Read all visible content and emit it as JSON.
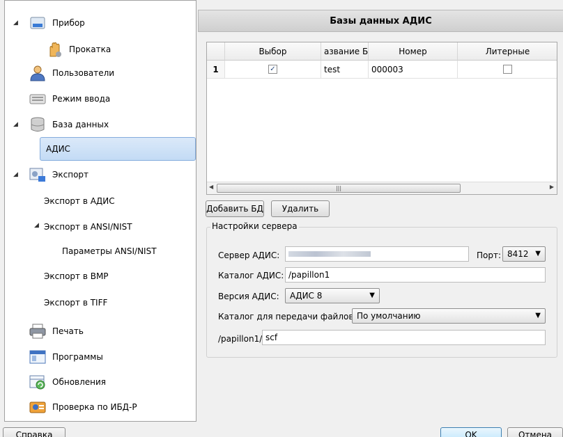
{
  "tree": {
    "items": [
      {
        "label": "Прибор",
        "icon": "device-icon"
      },
      {
        "label": "Прокатка",
        "icon": "hand-icon"
      },
      {
        "label": "Пользователи",
        "icon": "user-icon"
      },
      {
        "label": "Режим ввода",
        "icon": "keyboard-icon"
      },
      {
        "label": "База данных",
        "icon": "database-icon"
      },
      {
        "label": "АДИС"
      },
      {
        "label": "Экспорт",
        "icon": "export-icon"
      },
      {
        "label": "Экспорт в АДИС"
      },
      {
        "label": "Экспорт в ANSI/NIST"
      },
      {
        "label": "Параметры ANSI/NIST"
      },
      {
        "label": "Экспорт в BMP"
      },
      {
        "label": "Экспорт в TIFF"
      },
      {
        "label": "Печать",
        "icon": "printer-icon"
      },
      {
        "label": "Программы",
        "icon": "window-icon"
      },
      {
        "label": "Обновления",
        "icon": "update-icon"
      },
      {
        "label": "Проверка по ИБД-Р",
        "icon": "check-icon"
      }
    ]
  },
  "panel": {
    "title": "Базы данных АДИС"
  },
  "table": {
    "columns": [
      "Выбор",
      "азвание Б",
      "Номер",
      "Литерные"
    ],
    "rows": [
      {
        "index": "1",
        "selected": true,
        "name": "test",
        "number": "000003",
        "literal": false
      }
    ]
  },
  "buttons": {
    "add": "Добавить БД",
    "delete": "Удалить",
    "help": "Справка",
    "ok": "OK",
    "cancel": "Отмена"
  },
  "server": {
    "group_title": "Настройки сервера",
    "server_label": "Сервер АДИС:",
    "server_value": "",
    "port_label": "Порт:",
    "port_value": "8412",
    "catalog_label": "Каталог АДИС:",
    "catalog_value": "/papillon1",
    "version_label": "Версия АДИС:",
    "version_value": "АДИС 8",
    "transfer_label": "Каталог для передачи файлов:",
    "transfer_value": "По умолчанию",
    "subpath_label": "/papillon1/",
    "subpath_value": "scf"
  },
  "colors": {
    "selection": "#c3dbf5",
    "header": "#d8d8d8"
  }
}
